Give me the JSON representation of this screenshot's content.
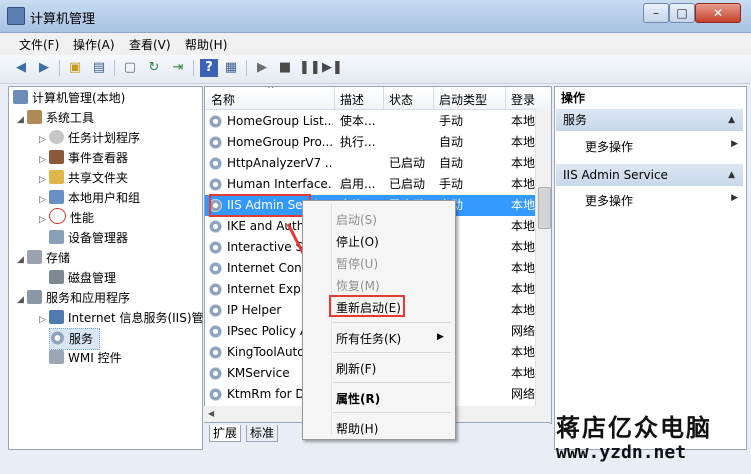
{
  "window": {
    "title": "计算机管理",
    "controls": {
      "minimize": "–",
      "maximize": "□",
      "close": "✕"
    }
  },
  "menu": [
    "文件(F)",
    "操作(A)",
    "查看(V)",
    "帮助(H)"
  ],
  "toolbar_icons": [
    "back-icon",
    "forward-icon",
    "up-folder-icon",
    "show-tree-icon",
    "properties-icon",
    "refresh-icon",
    "export-icon",
    "help-icon",
    "view-icon",
    "play-icon",
    "stop-icon",
    "pause-icon",
    "restart-icon"
  ],
  "tree": [
    {
      "label": "计算机管理(本地)"
    },
    {
      "label": "系统工具"
    },
    {
      "label": "任务计划程序"
    },
    {
      "label": "事件查看器"
    },
    {
      "label": "共享文件夹"
    },
    {
      "label": "本地用户和组"
    },
    {
      "label": "性能"
    },
    {
      "label": "设备管理器"
    },
    {
      "label": "存储"
    },
    {
      "label": "磁盘管理"
    },
    {
      "label": "服务和应用程序"
    },
    {
      "label": "Internet 信息服务(IIS)管"
    },
    {
      "label": "服务"
    },
    {
      "label": "WMI 控件"
    }
  ],
  "list": {
    "columns": [
      "名称",
      "描述",
      "状态",
      "启动类型",
      "登录"
    ],
    "rows": [
      {
        "name": "HomeGroup List...",
        "desc": "使本...",
        "status": "",
        "startup": "手动",
        "logon": "本地"
      },
      {
        "name": "HomeGroup Pro...",
        "desc": "执行...",
        "status": "",
        "startup": "自动",
        "logon": "本地"
      },
      {
        "name": "HttpAnalyzerV7 ...",
        "desc": "",
        "status": "已启动",
        "startup": "自动",
        "logon": "本地"
      },
      {
        "name": "Human Interface...",
        "desc": "启用...",
        "status": "已启动",
        "startup": "手动",
        "logon": "本地"
      },
      {
        "name": "IIS Admin Servi",
        "desc": "允许",
        "status": "已启动",
        "startup": "自动",
        "logon": "本地"
      },
      {
        "name": "IKE and Auth",
        "desc": "",
        "status": "",
        "startup": "",
        "logon": "本地"
      },
      {
        "name": "Interactive S",
        "desc": "",
        "status": "",
        "startup": "",
        "logon": "本地"
      },
      {
        "name": "Internet Conn",
        "desc": "",
        "status": "",
        "startup": "",
        "logon": "本地"
      },
      {
        "name": "Internet Explo",
        "desc": "",
        "status": "",
        "startup": "",
        "logon": "本地"
      },
      {
        "name": "IP Helper",
        "desc": "",
        "status": "",
        "startup": "",
        "logon": "本地"
      },
      {
        "name": "IPsec Policy A",
        "desc": "",
        "status": "",
        "startup": "",
        "logon": "网络"
      },
      {
        "name": "KingToolAuto",
        "desc": "",
        "status": "",
        "startup": "",
        "logon": "本地"
      },
      {
        "name": "KMService",
        "desc": "",
        "status": "",
        "startup": "",
        "logon": "本地"
      },
      {
        "name": "KtmRm for D",
        "desc": "",
        "status": "",
        "startup": "",
        "logon": "网络"
      }
    ],
    "tabs": [
      "扩展",
      "标准"
    ]
  },
  "actions": {
    "title": "操作",
    "sections": [
      {
        "title": "服务",
        "item": "更多操作"
      },
      {
        "title": "IIS Admin Service",
        "item": "更多操作"
      }
    ]
  },
  "context_menu": {
    "items": [
      {
        "label": "启动(S)",
        "disabled": true
      },
      {
        "label": "停止(O)",
        "disabled": false
      },
      {
        "label": "暂停(U)",
        "disabled": true
      },
      {
        "label": "恢复(M)",
        "disabled": true
      },
      {
        "label": "重新启动(E)",
        "disabled": false
      },
      {
        "label": "所有任务(K)",
        "disabled": false
      },
      {
        "label": "刷新(F)",
        "disabled": false
      },
      {
        "label": "属性(R)",
        "disabled": false
      },
      {
        "label": "帮助(H)",
        "disabled": false
      }
    ]
  },
  "watermark": {
    "brand": "蒋店亿众电脑",
    "url": "www.yzdn.net"
  },
  "colors": {
    "selection": "#3399ff",
    "highlight_box": "#e53935",
    "section_header": "#c8d7ea"
  }
}
